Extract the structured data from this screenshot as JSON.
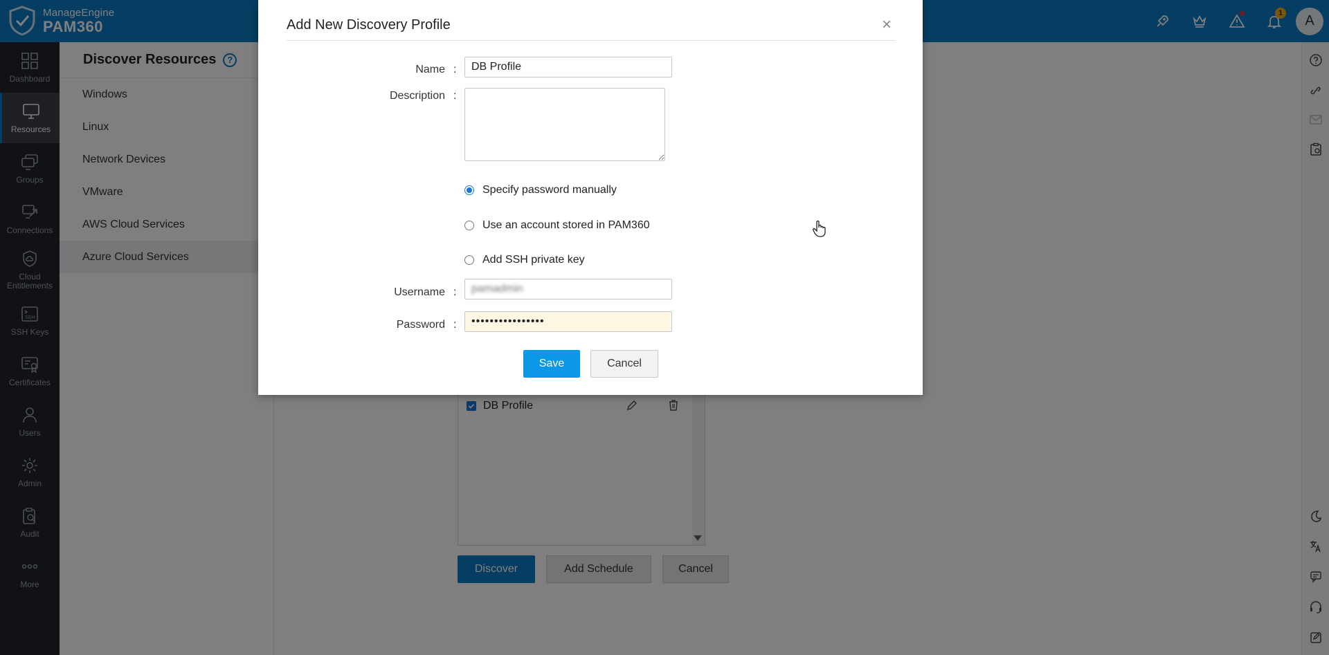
{
  "header": {
    "brand_top": "ManageEngine",
    "brand_main": "PAM360",
    "icons": [
      "rocket-icon",
      "crown-icon",
      "alert-icon",
      "bell-icon"
    ],
    "notification_count": "1",
    "avatar_letter": "A",
    "colors": {
      "topbar": "#0a7cc4"
    }
  },
  "leftnav": {
    "items": [
      {
        "label": "Dashboard",
        "icon": "dashboard-icon"
      },
      {
        "label": "Resources",
        "icon": "monitor-icon"
      },
      {
        "label": "Groups",
        "icon": "groups-icon"
      },
      {
        "label": "Connections",
        "icon": "connections-icon"
      },
      {
        "label": "Cloud Entitlements",
        "icon": "cloud-shield-icon"
      },
      {
        "label": "SSH Keys",
        "icon": "ssh-icon"
      },
      {
        "label": "Certificates",
        "icon": "certificate-icon"
      },
      {
        "label": "Users",
        "icon": "user-icon"
      },
      {
        "label": "Admin",
        "icon": "gear-icon"
      },
      {
        "label": "Audit",
        "icon": "audit-icon"
      },
      {
        "label": "More",
        "icon": "more-icon"
      }
    ],
    "active_index": 1
  },
  "subnav": {
    "title": "Discover Resources",
    "help_glyph": "?",
    "items": [
      "Windows",
      "Linux",
      "Network Devices",
      "VMware",
      "AWS Cloud Services",
      "Azure Cloud Services"
    ],
    "active_index": 5
  },
  "main": {
    "profile_name": "DB Profile",
    "discover_label": "Discover",
    "add_schedule_label": "Add Schedule",
    "cancel_label": "Cancel"
  },
  "modal": {
    "title": "Add New Discovery Profile",
    "close_glyph": "×",
    "colon": ":",
    "name_label": "Name",
    "name_value": "DB Profile",
    "description_label": "Description",
    "description_value": "",
    "radio_options": [
      "Specify password manually",
      "Use an account stored in PAM360",
      "Add SSH private key"
    ],
    "selected_radio": 0,
    "username_label": "Username",
    "username_value": "pamadmin",
    "password_label": "Password",
    "password_value": "••••••••••••••••",
    "save_label": "Save",
    "cancel_label": "Cancel"
  }
}
